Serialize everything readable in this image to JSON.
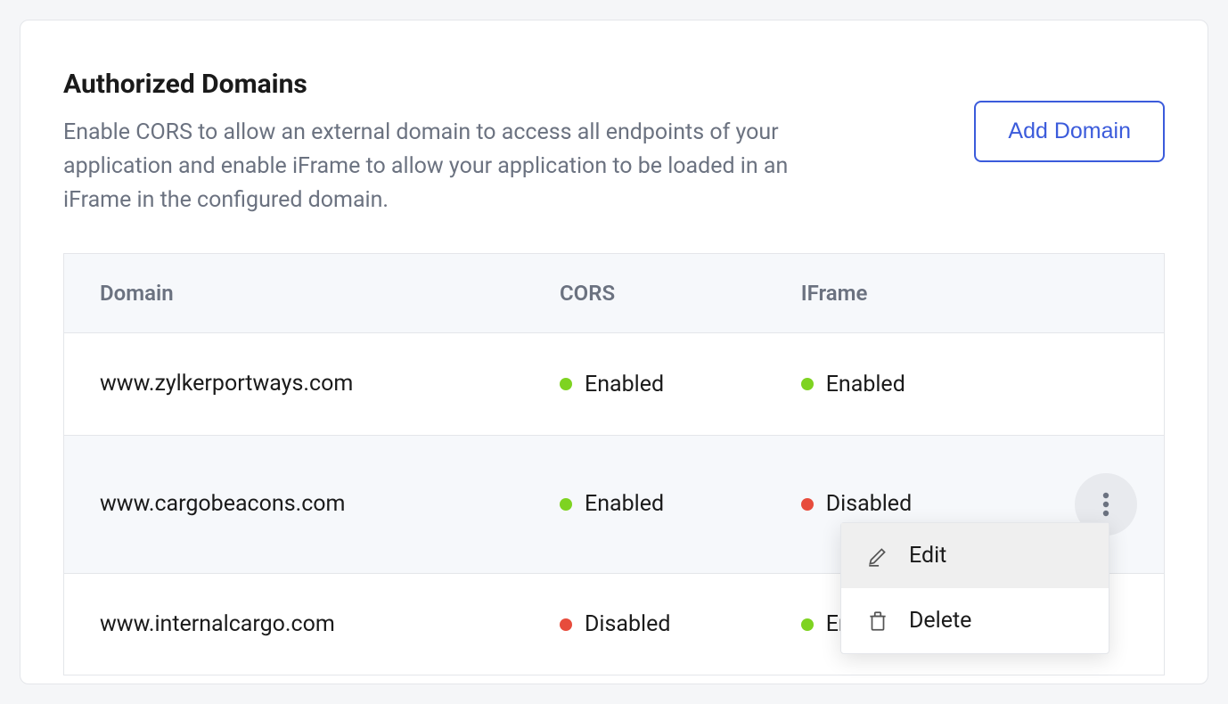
{
  "section": {
    "title": "Authorized Domains",
    "description": "Enable CORS to allow an external domain to access all endpoints of your application and enable iFrame to allow your application to be loaded in an iFrame in the configured domain.",
    "add_button": "Add Domain"
  },
  "table": {
    "headers": {
      "domain": "Domain",
      "cors": "CORS",
      "iframe": "IFrame"
    },
    "status_labels": {
      "enabled": "Enabled",
      "disabled": "Disabled"
    },
    "rows": [
      {
        "domain": "www.zylkerportways.com",
        "cors": "enabled",
        "iframe": "enabled"
      },
      {
        "domain": "www.cargobeacons.com",
        "cors": "enabled",
        "iframe": "disabled"
      },
      {
        "domain": "www.internalcargo.com",
        "cors": "disabled",
        "iframe": "enabled"
      }
    ]
  },
  "menu": {
    "edit": "Edit",
    "delete": "Delete"
  },
  "colors": {
    "accent": "#3b5bdb",
    "enabled_dot": "#7ed321",
    "disabled_dot": "#e74c3c"
  }
}
